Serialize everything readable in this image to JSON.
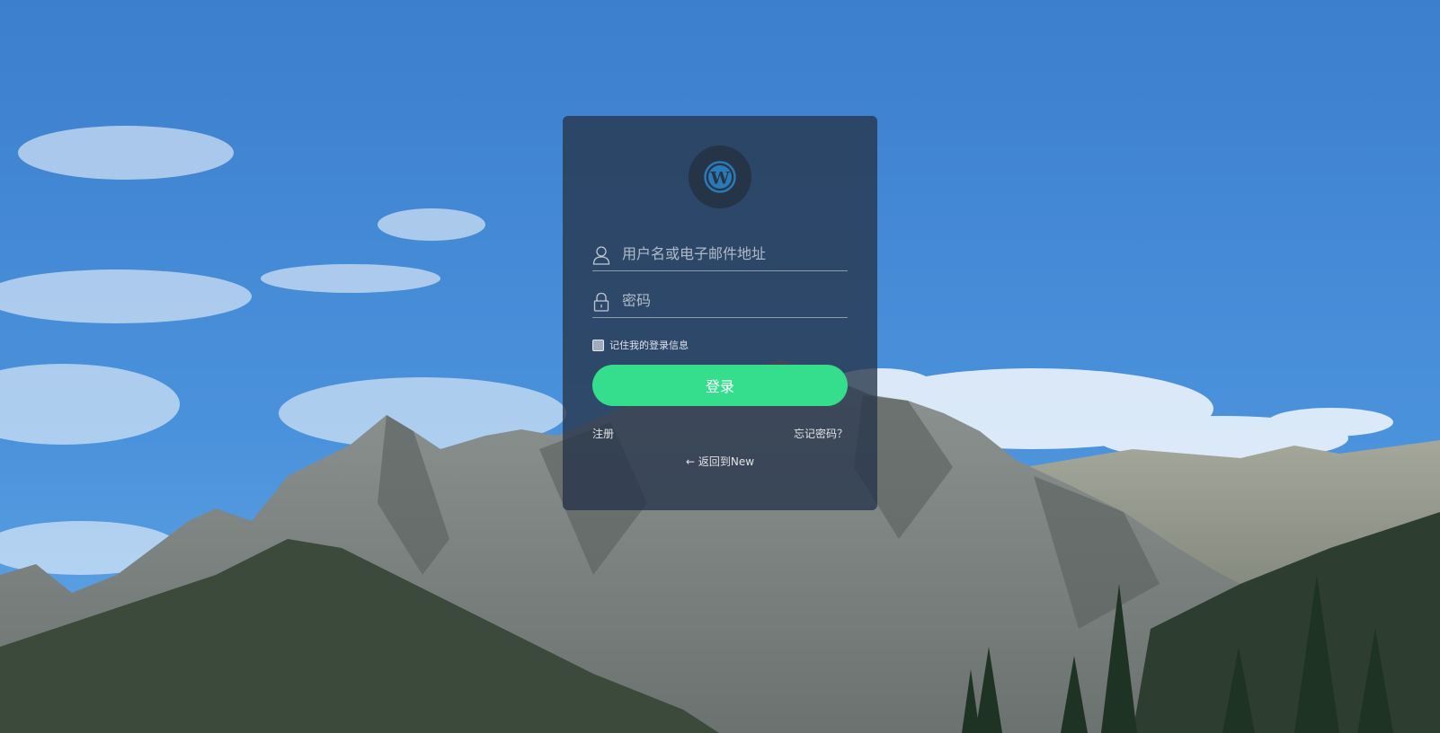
{
  "login": {
    "username_placeholder": "用户名或电子邮件地址",
    "password_placeholder": "密码",
    "remember_label": "记住我的登录信息",
    "login_button": "登录",
    "register_link": "注册",
    "forgot_link": "忘记密码？",
    "back_link": "← 返回到New"
  },
  "icons": {
    "logo": "wordpress-icon",
    "username": "user-icon",
    "password": "lock-icon"
  },
  "colors": {
    "accent": "#34de8d",
    "card": "rgba(38,52,74,0.78)",
    "logo": "#2a7ab8"
  }
}
